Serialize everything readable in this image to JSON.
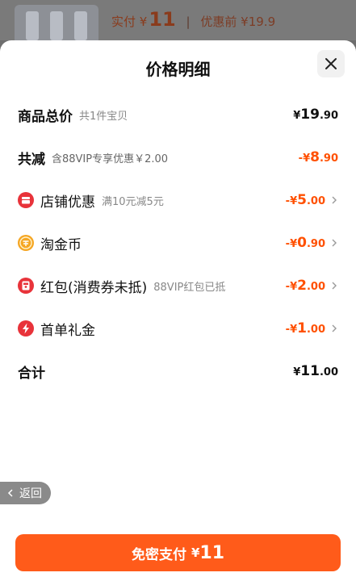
{
  "top_strip": {
    "paid_label": "实付",
    "paid_currency": "¥",
    "paid_value": "11",
    "pre_discount_label": "优惠前",
    "pre_discount_value": "¥19.9"
  },
  "sheet": {
    "title": "价格明细"
  },
  "rows": {
    "total": {
      "label": "商品总价",
      "note": "共1件宝贝",
      "currency": "¥",
      "int": "19",
      "dec": ".90"
    },
    "reduce": {
      "label": "共减",
      "note": "含88VIP专享优惠￥2.00",
      "currency": "-¥",
      "int": "8",
      "dec": ".90"
    },
    "shop": {
      "label": "店铺优惠",
      "note": "满10元减5元",
      "currency": "-¥",
      "int": "5",
      "dec": ".00"
    },
    "coin": {
      "label": "淘金币",
      "currency": "-¥",
      "int": "0",
      "dec": ".90"
    },
    "redpacket": {
      "label": "红包(消费券未抵)",
      "note": "88VIP红包已抵",
      "currency": "-¥",
      "int": "2",
      "dec": ".00"
    },
    "firstorder": {
      "label": "首单礼金",
      "currency": "-¥",
      "int": "1",
      "dec": ".00"
    },
    "sum": {
      "label": "合计",
      "currency": "¥",
      "int": "11",
      "dec": ".00"
    }
  },
  "back": {
    "label": "返回"
  },
  "pay": {
    "label": "免密支付",
    "currency": "¥",
    "value": "11"
  },
  "colors": {
    "accent": "#ff5000",
    "button": "#ff5b1a",
    "icon_red": "#e8333a",
    "icon_gold": "#f5a623"
  }
}
